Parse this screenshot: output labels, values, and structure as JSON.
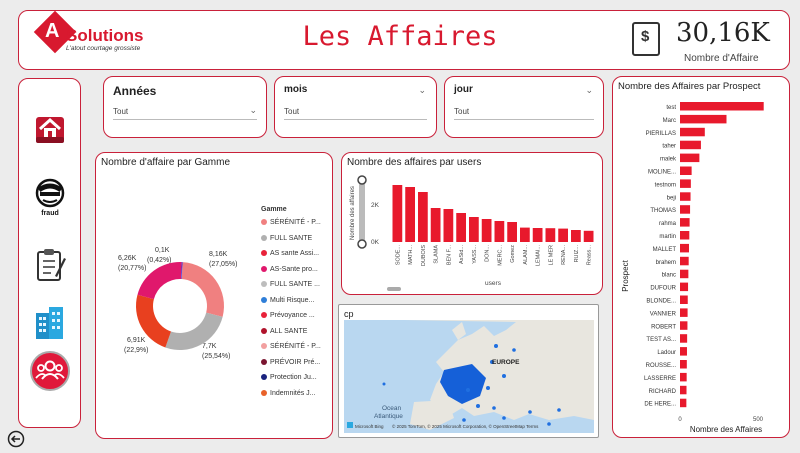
{
  "header": {
    "brand_letter": "A",
    "brand_name": "Solutions",
    "brand_tagline": "L'atout courtage grossiste",
    "page_title": "Les Affaires",
    "kpi_value": "30,16K",
    "kpi_label": "Nombre d'Affaire"
  },
  "nav": [
    {
      "name": "home-icon"
    },
    {
      "name": "fraud-icon",
      "label": "fraud"
    },
    {
      "name": "clipboard-icon"
    },
    {
      "name": "buildings-icon"
    },
    {
      "name": "users-icon"
    }
  ],
  "filters": {
    "annees": {
      "label": "Années",
      "value": "Tout"
    },
    "mois": {
      "label": "mois",
      "value": "Tout"
    },
    "jour": {
      "label": "jour",
      "value": "Tout"
    }
  },
  "gamme_chart": {
    "title": "Nombre d'affaire par Gamme",
    "legend_title": "Gamme",
    "labels": {
      "l1": "0,1K",
      "l1b": "(0,42%)",
      "l2": "6,26K",
      "l2b": "(20,77%)",
      "l3": "8,16K",
      "l3b": "(27,05%)",
      "l4": "6,91K",
      "l4b": "(22,9%)",
      "l5": "7,7K",
      "l5b": "(25,54%)"
    }
  },
  "users_chart": {
    "title": "Nombre des affaires par users",
    "ylabel": "Nombre des affaires",
    "xlabel": "users",
    "ticks": [
      "2K",
      "0K"
    ]
  },
  "map": {
    "title": "cp",
    "label_europe": "EUROPE",
    "label_ocean": "Ocean\nAtlantique",
    "attribution": "© 2025 TomTom, © 2025 Microsoft Corporation, © OpenStreetMap  Terms",
    "provider": "Microsoft Bing"
  },
  "prospect_chart": {
    "title": "Nombre des Affaires par Prospect",
    "ylabel": "Prospect",
    "xlabel": "Nombre des Affaires",
    "ticks": [
      "0",
      "500"
    ]
  },
  "chart_data": [
    {
      "type": "pie",
      "title": "Nombre d'affaire par Gamme",
      "legend_title": "Gamme",
      "categories": [
        "SÉRÉNITÉ - P...",
        "FULL SANTE",
        "AS sante Assi...",
        "AS-Sante pro...",
        "FULL SANTE ...",
        "Multi Risque...",
        "Prévoyance ...",
        "ALL SANTE",
        "SÉRÉNITÉ - P...",
        "PRÉVOIR Pré...",
        "Protection Ju...",
        "Indemnités J..."
      ],
      "colors": [
        "#f08080",
        "#b0b0b0",
        "#e8223a",
        "#e0186c",
        "#bdbdbd",
        "#2f7ed8",
        "#e8223a",
        "#b0122b",
        "#f2a0a0",
        "#7a1530",
        "#1a237e",
        "#e8622a"
      ],
      "values": [
        8.16,
        7.7,
        6.91,
        6.26,
        0.1
      ]
    },
    {
      "type": "bar",
      "title": "Nombre des affaires par users",
      "xlabel": "users",
      "ylabel": "Nombre des affaires",
      "categories": [
        "SODE...",
        "MATH...",
        "DUBOIS",
        "SLAMA",
        "BEN F...",
        "AsSid...",
        "YASS...",
        "DON...",
        "MERC...",
        "Gomez",
        "ALAM...",
        "LEMAI...",
        "LE MER",
        "RENA...",
        "RUIZ...",
        "Reass..."
      ],
      "values": [
        2850,
        2750,
        2500,
        1700,
        1650,
        1450,
        1250,
        1150,
        1050,
        1000,
        720,
        700,
        690,
        670,
        600,
        560
      ],
      "ylim": [
        0,
        3000
      ]
    },
    {
      "type": "bar",
      "title": "Nombre des Affaires par Prospect",
      "orientation": "horizontal",
      "xlabel": "Nombre des Affaires",
      "ylabel": "Prospect",
      "categories": [
        "test",
        "Marc",
        "PIERILLAS",
        "taher",
        "malek",
        "MOLINE...",
        "testnom",
        "beji",
        "THOMAS",
        "rahma",
        "martin",
        "MALLET",
        "brahem",
        "blanc",
        "DUFOUR",
        "BLONDE...",
        "VANNIER",
        "ROBERT",
        "TEST AS...",
        "Ladour",
        "ROUSSE...",
        "LASSERRE",
        "RICHARD",
        "DE HERE..."
      ],
      "values": [
        540,
        300,
        160,
        135,
        125,
        75,
        70,
        68,
        65,
        62,
        60,
        58,
        56,
        54,
        52,
        50,
        49,
        48,
        46,
        45,
        44,
        43,
        42,
        41
      ],
      "xlim": [
        0,
        600
      ]
    }
  ]
}
